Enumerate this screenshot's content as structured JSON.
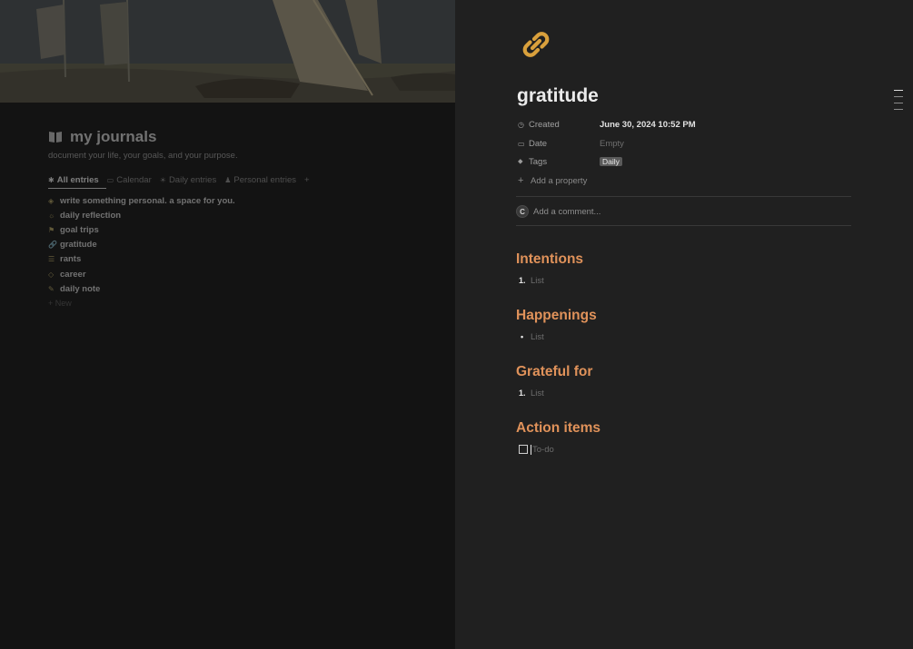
{
  "journal": {
    "title": "my journals",
    "subtitle": "document your life, your goals, and your purpose.",
    "tabs": [
      {
        "icon": "✱",
        "label": "All entries"
      },
      {
        "icon": "▭",
        "label": "Calendar"
      },
      {
        "icon": "☀",
        "label": "Daily entries"
      },
      {
        "icon": "♟",
        "label": "Personal entries"
      }
    ],
    "tabs_more": "+",
    "items": [
      {
        "icon": "◈",
        "label": "write something personal. a space for you."
      },
      {
        "icon": "☼",
        "label": "daily reflection"
      },
      {
        "icon": "⚑",
        "label": "goal trips"
      },
      {
        "icon": "🔗",
        "label": "gratitude"
      },
      {
        "icon": "☰",
        "label": "rants"
      },
      {
        "icon": "◇",
        "label": "career"
      },
      {
        "icon": "✎",
        "label": "daily note"
      }
    ],
    "new_label": "+ New"
  },
  "page": {
    "icon": "link-icon",
    "title": "gratitude",
    "properties": [
      {
        "icon": "◷",
        "name": "Created",
        "value": "June 30, 2024 10:52 PM"
      },
      {
        "icon": "▭",
        "name": "Date",
        "value": "Empty"
      },
      {
        "icon": "⬥",
        "name": "Tags",
        "value": "Daily"
      }
    ],
    "add_property": "Add a property",
    "comment_avatar": "C",
    "comment_placeholder": "Add a comment...",
    "sections": [
      {
        "heading": "Intentions",
        "marker": "1.",
        "placeholder": "List"
      },
      {
        "heading": "Happenings",
        "marker": "•",
        "placeholder": "List"
      },
      {
        "heading": "Grateful for",
        "marker": "1.",
        "placeholder": "List"
      },
      {
        "heading": "Action items",
        "marker": "",
        "placeholder": "To-do"
      }
    ]
  },
  "colors": {
    "heading": "#e0925a",
    "icon_gold": "#d9a03c",
    "panel_bg": "#202020"
  }
}
